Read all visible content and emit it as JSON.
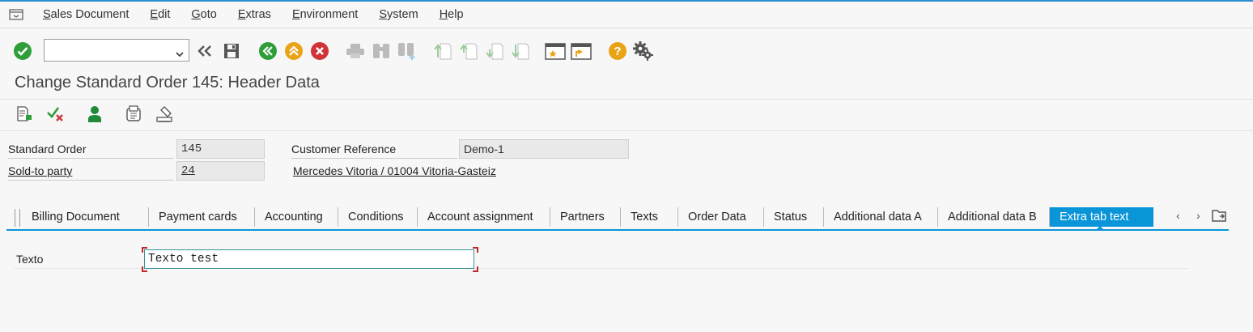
{
  "menu": {
    "items": [
      "Sales Document",
      "Edit",
      "Goto",
      "Extras",
      "Environment",
      "System",
      "Help"
    ]
  },
  "toolbar": {
    "command_field_value": "",
    "icons": [
      "enter-icon",
      "command-field",
      "back-arrows-icon",
      "save-icon",
      "back-icon",
      "exit-icon",
      "cancel-icon",
      "print-icon",
      "find-icon",
      "find-next-icon",
      "first-page-icon",
      "previous-page-icon",
      "next-page-icon",
      "last-page-icon",
      "create-session-icon",
      "shortcut-icon",
      "help-icon",
      "customize-layout-icon"
    ],
    "colors": {
      "green": "#2e9e3a",
      "yellow": "#e8a317",
      "red": "#d13438",
      "gray": "#b4b4b4"
    }
  },
  "title": "Change Standard Order 145: Header Data",
  "header": {
    "standard_order_label": "Standard Order",
    "standard_order_value": "145",
    "customer_reference_label": "Customer Reference",
    "customer_reference_value": "Demo-1",
    "sold_to_party_label": "Sold-to party",
    "sold_to_party_value": "24",
    "sold_to_party_address": "Mercedes Vitoria / 01004 Vitoria-Gasteiz"
  },
  "tabs": [
    {
      "label": "Billing Document",
      "active": false
    },
    {
      "label": "Payment cards",
      "active": false
    },
    {
      "label": "Accounting",
      "active": false
    },
    {
      "label": "Conditions",
      "active": false
    },
    {
      "label": "Account assignment",
      "active": false
    },
    {
      "label": "Partners",
      "active": false
    },
    {
      "label": "Texts",
      "active": false
    },
    {
      "label": "Order Data",
      "active": false
    },
    {
      "label": "Status",
      "active": false
    },
    {
      "label": "Additional data A",
      "active": false
    },
    {
      "label": "Additional data B",
      "active": false
    },
    {
      "label": "Extra tab text",
      "active": true
    }
  ],
  "content": {
    "texto_label": "Texto",
    "texto_value": "Texto test"
  }
}
